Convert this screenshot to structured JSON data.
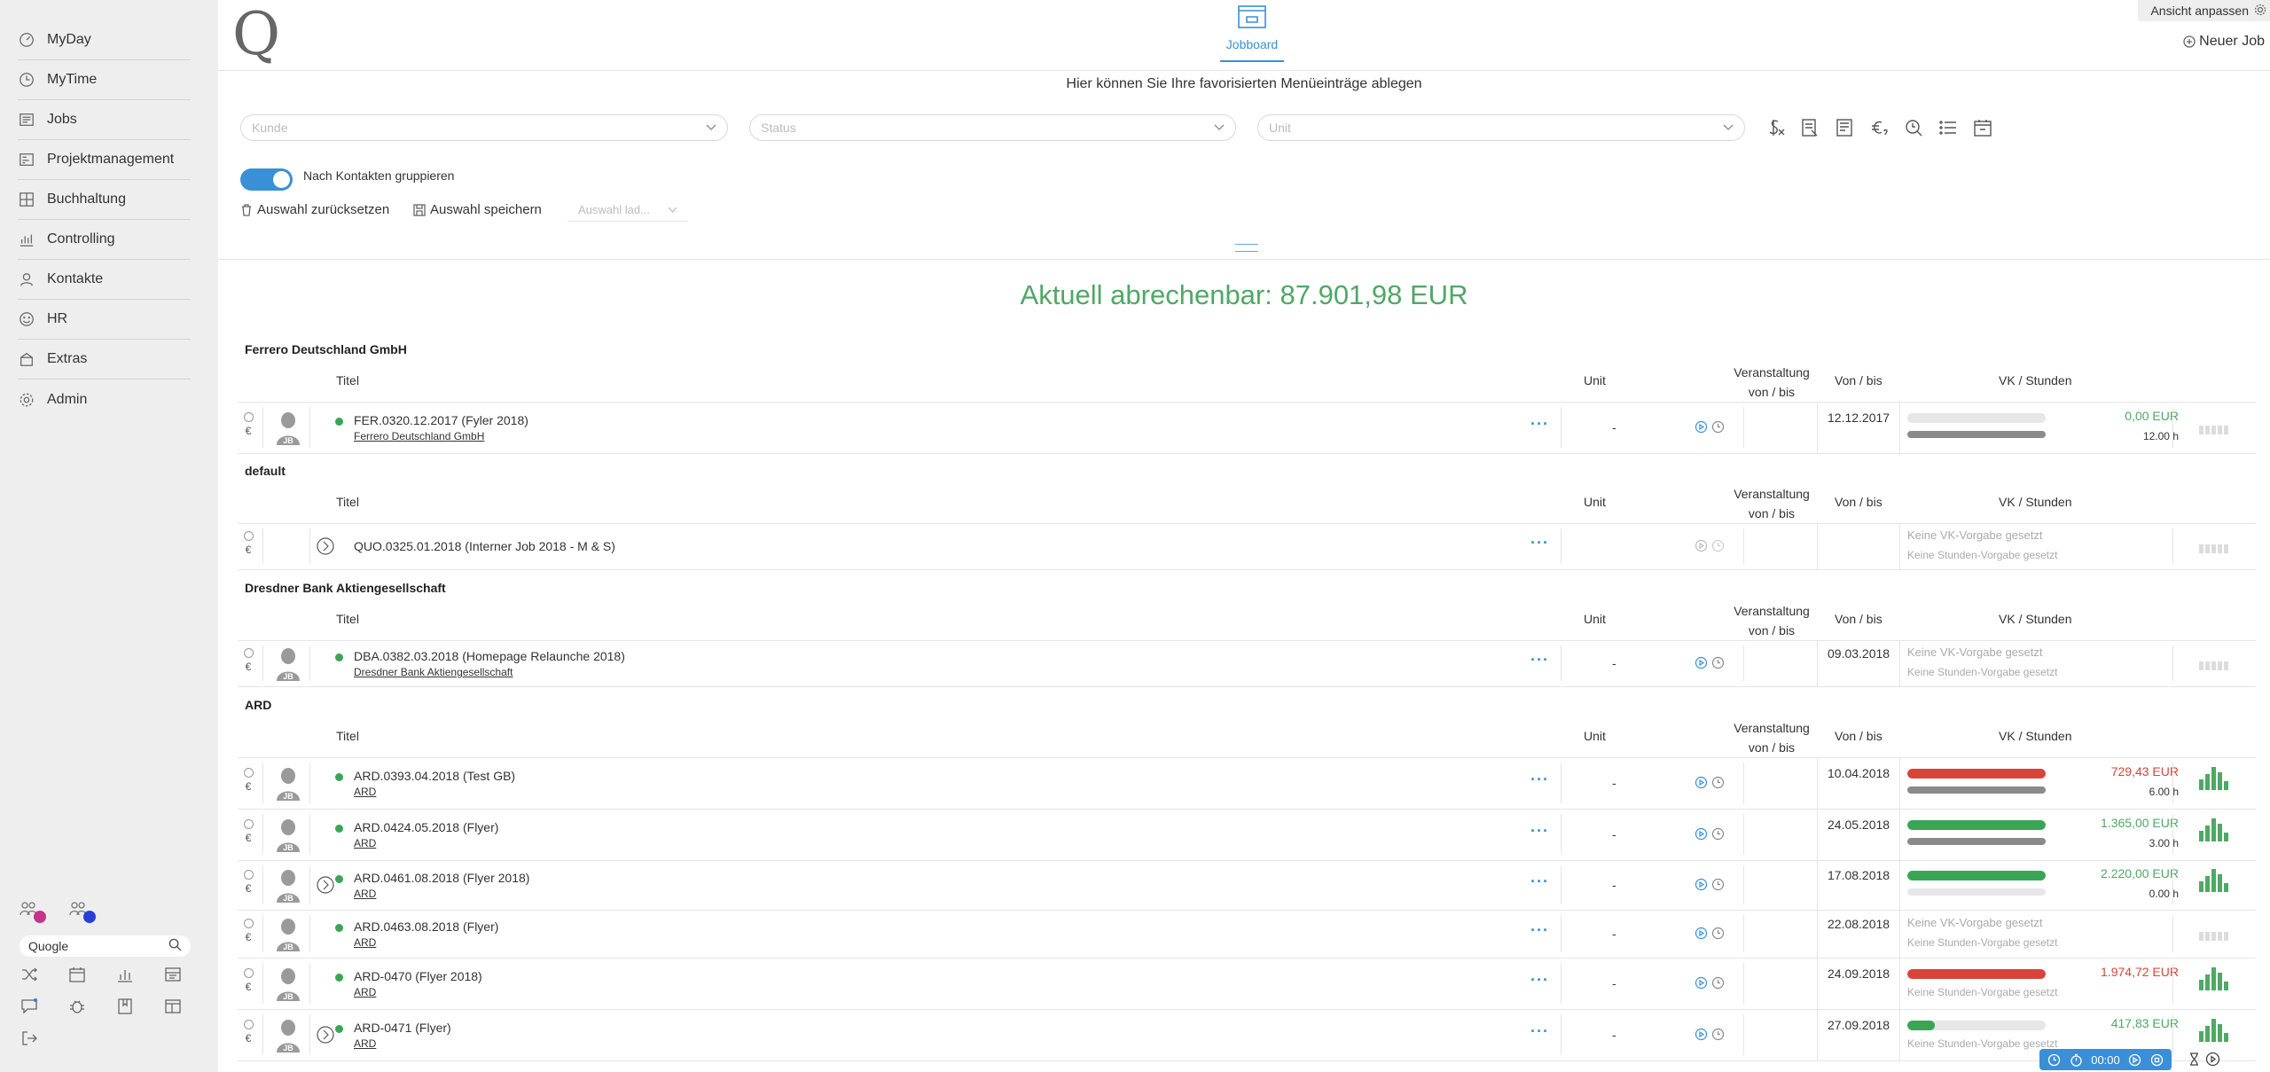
{
  "sidebar": {
    "items": [
      {
        "label": "MyDay",
        "icon": "dashboard-icon"
      },
      {
        "label": "MyTime",
        "icon": "clock-icon"
      },
      {
        "label": "Jobs",
        "icon": "jobs-icon"
      },
      {
        "label": "Projektmanagement",
        "icon": "project-icon"
      },
      {
        "label": "Buchhaltung",
        "icon": "accounting-icon"
      },
      {
        "label": "Controlling",
        "icon": "controlling-icon"
      },
      {
        "label": "Kontakte",
        "icon": "contact-icon"
      },
      {
        "label": "HR",
        "icon": "smiley-icon"
      },
      {
        "label": "Extras",
        "icon": "extras-icon"
      },
      {
        "label": "Admin",
        "icon": "gear-icon"
      }
    ],
    "search_value": "Quogle",
    "avatar_dot_colors": [
      "#c2368a",
      "#2a3fd6"
    ]
  },
  "header": {
    "active_tab": "Jobboard",
    "ansicht_label": "Ansicht anpassen",
    "new_job_label": "Neuer Job"
  },
  "filters": {
    "favorites_hint": "Hier können Sie Ihre favorisierten Menüeinträge ablegen",
    "kunde_placeholder": "Kunde",
    "status_placeholder": "Status",
    "unit_placeholder": "Unit",
    "group_toggle_label": "Nach Kontakten gruppieren",
    "group_toggle_on": true,
    "reset_label": "Auswahl zurücksetzen",
    "save_label": "Auswahl speichern",
    "load_placeholder": "Auswahl lad..."
  },
  "summary": {
    "label": "Aktuell abrechenbar:",
    "amount": "87.901,98 EUR"
  },
  "columns": {
    "title": "Titel",
    "unit": "Unit",
    "event_1": "Veranstaltung",
    "event_2": "von / bis",
    "from_to": "Von / bis",
    "vk_hours": "VK / Stunden"
  },
  "labels": {
    "no_vk": "Keine VK-Vorgabe gesetzt",
    "no_hours": "Keine Stunden-Vorgabe gesetzt",
    "dash": "-",
    "euro": "€",
    "more": "···"
  },
  "groups": [
    {
      "name": "Ferrero Deutschland GmbH",
      "jobs": [
        {
          "title": "FER.0320.12.2017 (Fyler 2018)",
          "client": "Ferrero Deutschland GmbH",
          "date": "12.12.2017",
          "vk": "0,00 EUR",
          "vk_color": "#4fa865",
          "hours": "12.00 h",
          "vk_progress": 0,
          "hours_progress": 1,
          "bar_color": "#e7e7e7"
        }
      ]
    },
    {
      "name": "default",
      "jobs": [
        {
          "title": "QUO.0325.01.2018 (Interner Job 2018 - M & S)",
          "client": "",
          "date": "",
          "no_vk": true,
          "no_hours": true
        }
      ]
    },
    {
      "name": "Dresdner Bank Aktiengesellschaft",
      "jobs": [
        {
          "title": "DBA.0382.03.2018 (Homepage Relaunche 2018)",
          "client": "Dresdner Bank Aktiengesellschaft",
          "date": "09.03.2018",
          "no_vk": true,
          "no_hours": true
        }
      ]
    },
    {
      "name": "ARD",
      "jobs": [
        {
          "title": "ARD.0393.04.2018 (Test GB)",
          "client": "ARD",
          "date": "10.04.2018",
          "vk": "729,43 EUR",
          "vk_color": "#d8443a",
          "hours": "6.00 h",
          "vk_progress": 1,
          "hours_progress": 1,
          "bar_color": "#d8443a"
        },
        {
          "title": "ARD.0424.05.2018 (Flyer)",
          "client": "ARD",
          "date": "24.05.2018",
          "vk": "1.365,00 EUR",
          "vk_color": "#4fa865",
          "hours": "3.00 h",
          "vk_progress": 1,
          "hours_progress": 1,
          "bar_color": "#3aa655"
        },
        {
          "title": "ARD.0461.08.2018 (Flyer 2018)",
          "client": "ARD",
          "date": "17.08.2018",
          "vk": "2.220,00 EUR",
          "vk_color": "#4fa865",
          "hours": "0.00 h",
          "vk_progress": 1,
          "hours_progress": 0,
          "bar_color": "#3aa655"
        },
        {
          "title": "ARD.0463.08.2018 (Flyer)",
          "client": "ARD",
          "date": "22.08.2018",
          "no_vk": true,
          "no_hours": true
        },
        {
          "title": "ARD-0470 (Flyer 2018)",
          "client": "ARD",
          "date": "24.09.2018",
          "vk": "1.974,72 EUR",
          "vk_color": "#d8443a",
          "no_hours": true,
          "vk_progress": 1,
          "bar_color": "#d8443a"
        },
        {
          "title": "ARD-0471 (Flyer)",
          "client": "ARD",
          "date": "27.09.2018",
          "vk": "417,83 EUR",
          "vk_color": "#4fa865",
          "no_hours": true,
          "vk_progress": 0.2,
          "bar_color": "#3aa655"
        }
      ]
    }
  ],
  "timer": {
    "value": "00:00"
  }
}
